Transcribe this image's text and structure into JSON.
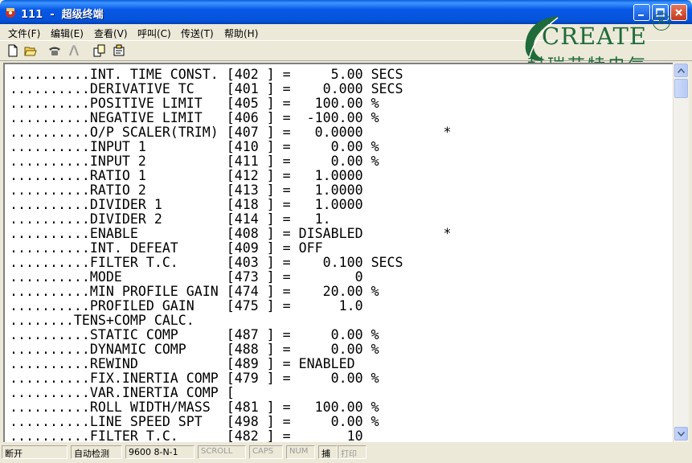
{
  "window": {
    "title": "111  -  超级终端"
  },
  "menu": [
    "文件(F)",
    "编辑(E)",
    "查看(V)",
    "呼叫(C)",
    "传送(T)",
    "帮助(H)"
  ],
  "toolbar": {
    "icons": [
      "new-connection-icon",
      "open-icon",
      "call-icon",
      "disconnect-icon",
      "send-icon",
      "properties-icon"
    ]
  },
  "logo": {
    "word": "CREATE",
    "registered": "R",
    "chinese": "科瑞艾特电气"
  },
  "terminal": {
    "lines": [
      "..........INT. TIME CONST. [402 ] =     5.00 SECS",
      "..........DERIVATIVE TC    [401 ] =    0.000 SECS",
      "..........POSITIVE LIMIT   [405 ] =   100.00 %",
      "..........NEGATIVE LIMIT   [406 ] =  -100.00 %",
      "..........O/P SCALER(TRIM) [407 ] =   0.0000          *",
      "..........INPUT 1          [410 ] =     0.00 %",
      "..........INPUT 2          [411 ] =     0.00 %",
      "..........RATIO 1          [412 ] =   1.0000",
      "..........RATIO 2          [413 ] =   1.0000",
      "..........DIVIDER 1        [418 ] =   1.0000",
      "..........DIVIDER 2        [414 ] =   1.",
      "..........ENABLE           [408 ] = DISABLED          *",
      "..........INT. DEFEAT      [409 ] = OFF",
      "..........FILTER T.C.      [403 ] =    0.100 SECS",
      "..........MODE             [473 ] =        0",
      "..........MIN PROFILE GAIN [474 ] =    20.00 %",
      "..........PROFILED GAIN    [475 ] =      1.0",
      "........TENS+COMP CALC.",
      "..........STATIC COMP      [487 ] =     0.00 %",
      "..........DYNAMIC COMP     [488 ] =     0.00 %",
      "..........REWIND           [489 ] = ENABLED",
      "..........FIX.INERTIA COMP [479 ] =     0.00 %",
      "..........VAR.INERTIA COMP [",
      "..........ROLL WIDTH/MASS  [481 ] =   100.00 %",
      "..........LINE SPEED SPT   [498 ] =     0.00 %",
      "..........FILTER T.C.      [482 ] =       10"
    ]
  },
  "statusbar": {
    "connection": "断开",
    "detect": "自动检测",
    "settings": "9600 8-N-1",
    "scroll": "SCROLL",
    "caps": "CAPS",
    "num": "NUM",
    "capture": "捕",
    "print": "打印"
  }
}
